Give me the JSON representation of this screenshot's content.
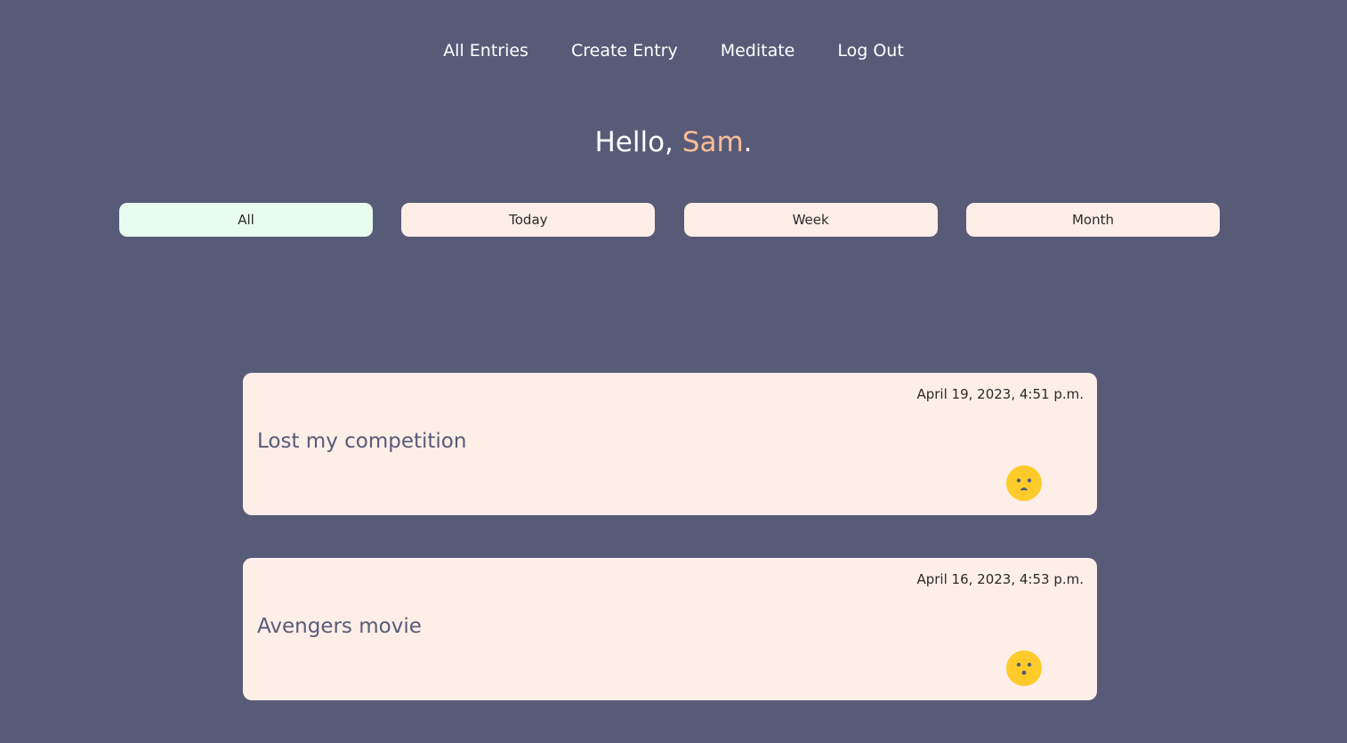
{
  "nav": {
    "items": [
      {
        "label": "All Entries"
      },
      {
        "label": "Create Entry"
      },
      {
        "label": "Meditate"
      },
      {
        "label": "Log Out"
      }
    ]
  },
  "greeting": {
    "prefix": "Hello, ",
    "name": "Sam",
    "suffix": "."
  },
  "filters": {
    "items": [
      {
        "label": "All",
        "active": true
      },
      {
        "label": "Today",
        "active": false
      },
      {
        "label": "Week",
        "active": false
      },
      {
        "label": "Month",
        "active": false
      }
    ]
  },
  "entries": [
    {
      "title": "Lost my competition",
      "date": "April 19, 2023, 4:51 p.m.",
      "mood_icon": "sad-face-icon"
    },
    {
      "title": "Avengers movie",
      "date": "April 16, 2023, 4:53 p.m.",
      "mood_icon": "surprised-face-icon"
    }
  ],
  "colors": {
    "background": "#585b78",
    "accent_name": "#fbbd97",
    "card": "#fdeee7",
    "active_filter": "#e9fdef",
    "emoji": "#fecb2b"
  }
}
